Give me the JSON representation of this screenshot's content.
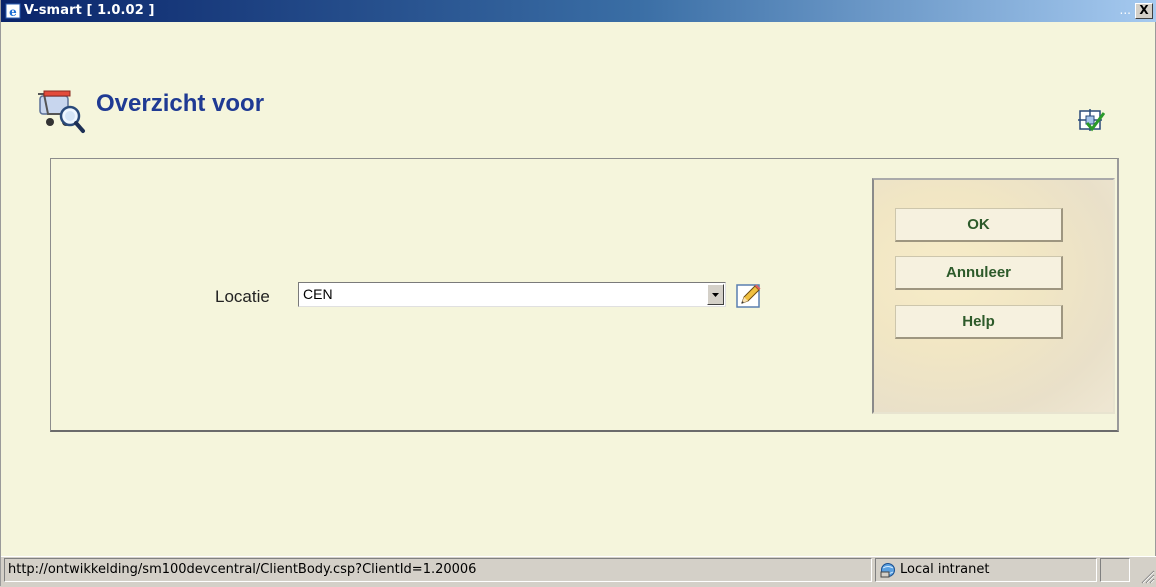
{
  "window": {
    "title": "V-smart [ 1.0.02 ]",
    "dots": "...",
    "close_label": "X"
  },
  "page": {
    "title": "Overzicht voor"
  },
  "form": {
    "location_label": "Locatie",
    "location_value": "CEN"
  },
  "buttons": {
    "ok": "OK",
    "cancel": "Annuleer",
    "help": "Help"
  },
  "statusbar": {
    "url": "http://ontwikkelding/sm100devcentral/ClientBody.csp?ClientId=1.20006",
    "zone": "Local intranet"
  },
  "icons": {
    "app": "ie-page-icon",
    "page": "cart-search-icon",
    "corner": "customize-checkmark-icon",
    "edit": "pencil-edit-icon",
    "zone": "local-intranet-icon"
  },
  "colors": {
    "titlebar_start": "#0a246a",
    "titlebar_end": "#a6caf0",
    "background": "#f5f5dc",
    "title_text": "#1f3a93",
    "button_text": "#2d5a2a"
  }
}
